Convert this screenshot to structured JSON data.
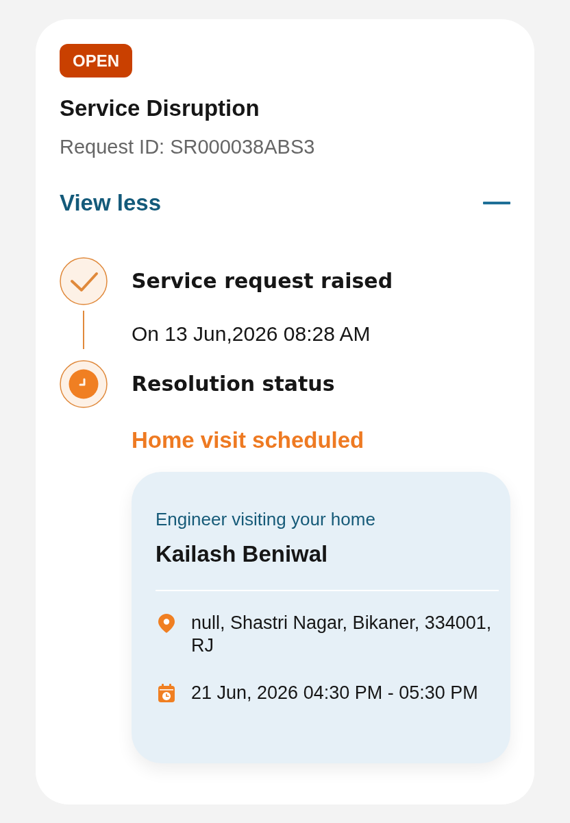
{
  "status_badge": {
    "label": "OPEN"
  },
  "title": "Service Disruption",
  "request_id": "Request ID: SR000038ABS3",
  "toggle": {
    "label": "View less",
    "expanded": true
  },
  "timeline": [
    {
      "kind": "done",
      "title": "Service request raised",
      "detail": "On 13 Jun,2026 08:28 AM"
    },
    {
      "kind": "in_progress",
      "title": "Resolution status",
      "status": "Home visit scheduled",
      "visit": {
        "heading": "Engineer visiting your home",
        "name": "Kailash Beniwal",
        "details": [
          {
            "kind": "address",
            "text": "null, Shastri Nagar, Bikaner, 334001, RJ"
          },
          {
            "kind": "schedule",
            "text": "21 Jun, 2026 04:30 PM - 05:30 PM"
          }
        ]
      }
    }
  ]
}
